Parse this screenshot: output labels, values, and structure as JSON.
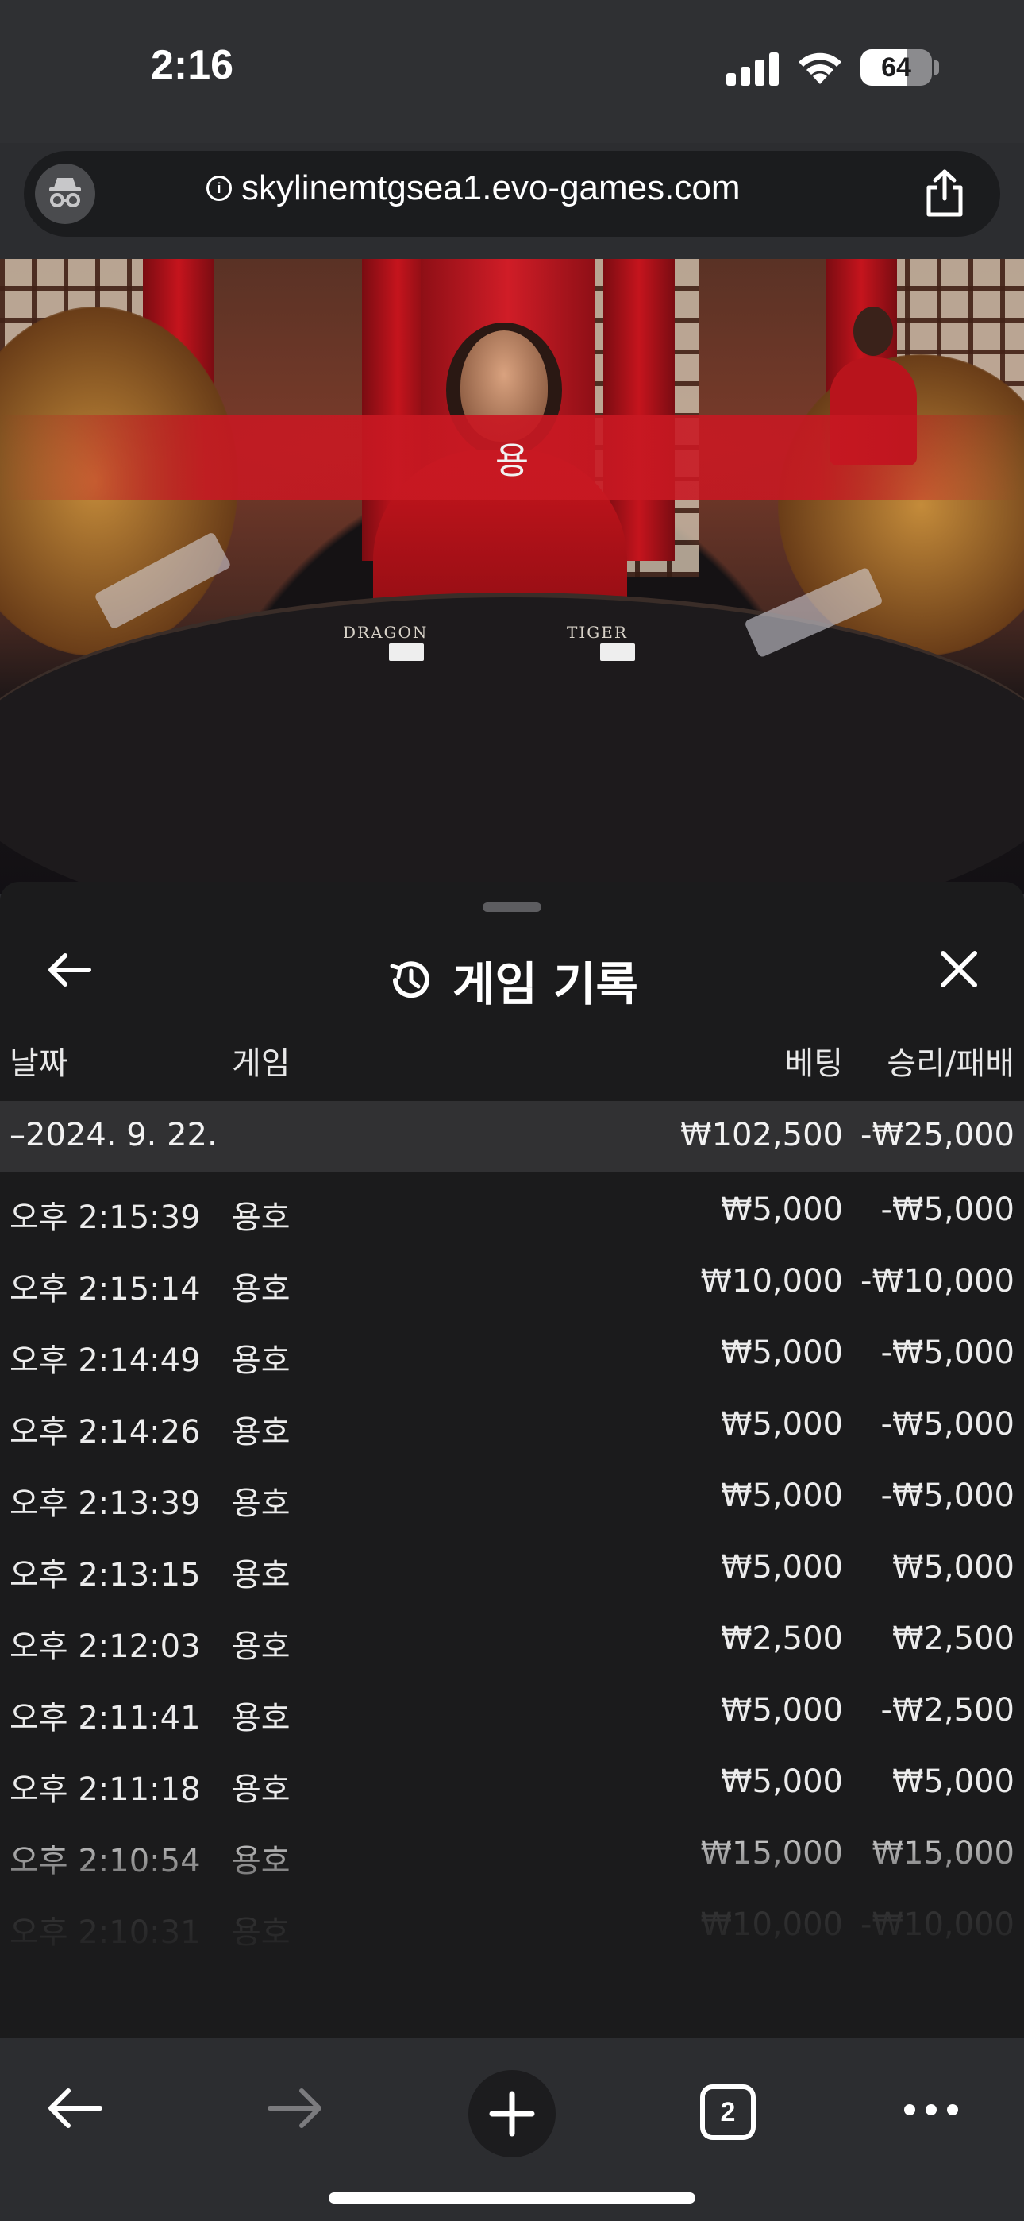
{
  "status_bar": {
    "time": "2:16",
    "battery": "64",
    "battery_level": 0.64
  },
  "browser": {
    "url": "skylinemtgsea1.evo-games.com"
  },
  "video": {
    "result_banner": "용",
    "table_labels": {
      "dragon": "DRAGON",
      "tiger": "TIGER"
    }
  },
  "panel": {
    "title": "게임 기록",
    "columns": {
      "date": "날짜",
      "game": "게임",
      "bet": "베팅",
      "winloss": "승리/패배"
    },
    "date_group": {
      "label": "–2024. 9. 22.",
      "bet": "₩102,500",
      "winloss": "-₩25,000"
    },
    "rows": [
      {
        "time": "오후 2:15:39",
        "game": "용호",
        "bet": "₩5,000",
        "winloss": "-₩5,000"
      },
      {
        "time": "오후 2:15:14",
        "game": "용호",
        "bet": "₩10,000",
        "winloss": "-₩10,000"
      },
      {
        "time": "오후 2:14:49",
        "game": "용호",
        "bet": "₩5,000",
        "winloss": "-₩5,000"
      },
      {
        "time": "오후 2:14:26",
        "game": "용호",
        "bet": "₩5,000",
        "winloss": "-₩5,000"
      },
      {
        "time": "오후 2:13:39",
        "game": "용호",
        "bet": "₩5,000",
        "winloss": "-₩5,000"
      },
      {
        "time": "오후 2:13:15",
        "game": "용호",
        "bet": "₩5,000",
        "winloss": "₩5,000"
      },
      {
        "time": "오후 2:12:03",
        "game": "용호",
        "bet": "₩2,500",
        "winloss": "₩2,500"
      },
      {
        "time": "오후 2:11:41",
        "game": "용호",
        "bet": "₩5,000",
        "winloss": "-₩2,500"
      },
      {
        "time": "오후 2:11:18",
        "game": "용호",
        "bet": "₩5,000",
        "winloss": "₩5,000"
      },
      {
        "time": "오후 2:10:54",
        "game": "용호",
        "bet": "₩15,000",
        "winloss": "₩15,000"
      },
      {
        "time": "오후 2:10:31",
        "game": "용호",
        "bet": "₩10,000",
        "winloss": "-₩10,000"
      }
    ]
  },
  "toolbar": {
    "tab_count": "2"
  },
  "icons": {
    "back": "arrow-left-icon",
    "forward": "arrow-right-icon",
    "new_tab": "plus-icon",
    "tabs": "tabs-icon",
    "more": "more-icon",
    "close": "close-icon",
    "history": "history-icon",
    "share": "share-icon",
    "incognito": "incognito-icon"
  },
  "colors": {
    "panel_bg": "#1b1b1c",
    "date_row_bg": "#313133",
    "banner_red": "#c81822"
  }
}
